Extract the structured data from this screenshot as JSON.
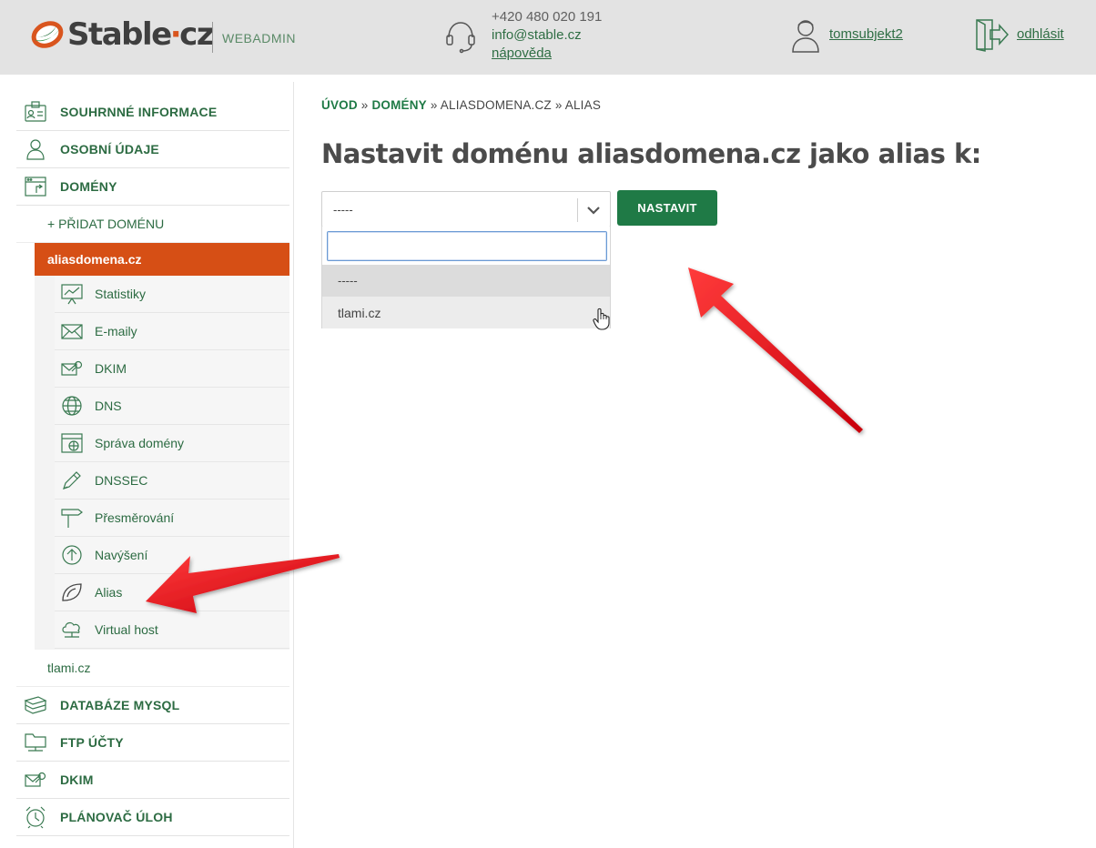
{
  "header": {
    "logo_text": "Stable",
    "logo_dot": "·",
    "logo_tld": "cz",
    "subtitle": "WEBADMIN",
    "phone": "+420 480 020 191",
    "email": "info@stable.cz",
    "help_label": "nápověda",
    "username": "tomsubjekt2",
    "logout_label": "odhlásit"
  },
  "sidebar": {
    "summary": "SOUHRNNÉ INFORMACE",
    "personal": "OSOBNÍ ÚDAJE",
    "domains": "DOMÉNY",
    "add_domain": "+ PŘIDAT DOMÉNU",
    "active_domain": "aliasdomena.cz",
    "subitems": [
      {
        "label": "Statistiky",
        "icon": "statistics-icon"
      },
      {
        "label": "E-maily",
        "icon": "envelope-icon"
      },
      {
        "label": "DKIM",
        "icon": "dkim-key-icon"
      },
      {
        "label": "DNS",
        "icon": "globe-icon"
      },
      {
        "label": "Správa domény",
        "icon": "domain-admin-icon"
      },
      {
        "label": "DNSSEC",
        "icon": "pen-icon"
      },
      {
        "label": "Přesměrování",
        "icon": "signpost-icon"
      },
      {
        "label": "Navýšení",
        "icon": "arrow-up-circle-icon"
      },
      {
        "label": "Alias",
        "icon": "alias-leaf-icon"
      },
      {
        "label": "Virtual host",
        "icon": "cloud-icon"
      }
    ],
    "other_domain": "tlami.cz",
    "databases": "DATABÁZE MYSQL",
    "ftp": "FTP ÚČTY",
    "dkim": "DKIM",
    "scheduler": "PLÁNOVAČ ÚLOH"
  },
  "breadcrumb": {
    "home": "ÚVOD",
    "sep": "»",
    "domains": "DOMÉNY",
    "domain": "ALIASDOMENA.CZ",
    "current": "ALIAS"
  },
  "main": {
    "title": "Nastavit doménu aliasdomena.cz jako alias k:",
    "select_value": "-----",
    "options": [
      "-----",
      "tlami.cz"
    ],
    "search_value": "",
    "submit_label": "NASTAVIT"
  },
  "colors": {
    "brand_green": "#1f7a46",
    "active_orange": "#d64f15",
    "header_bg": "#e3e3e3",
    "annotation_red": "#e0161e"
  }
}
